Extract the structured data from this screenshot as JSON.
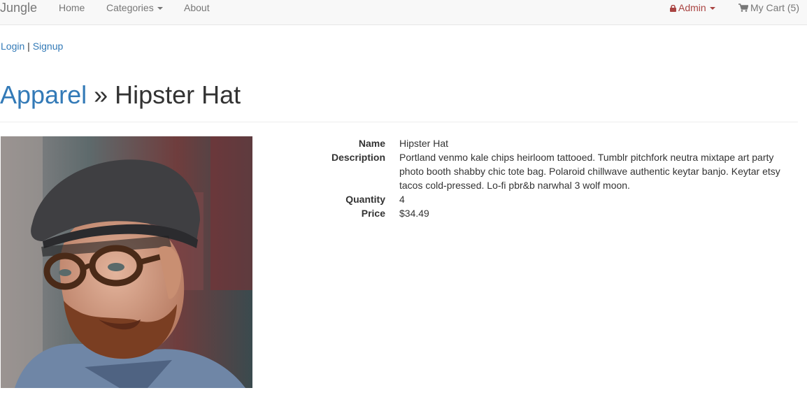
{
  "nav": {
    "brand": "Jungle",
    "home": "Home",
    "categories": "Categories",
    "about": "About",
    "admin": "Admin",
    "cart": "My Cart (5)"
  },
  "auth": {
    "login": "Login",
    "separator": " | ",
    "signup": "Signup"
  },
  "page": {
    "category": "Apparel",
    "separator": " » ",
    "product_name": "Hipster Hat"
  },
  "product": {
    "labels": {
      "name": "Name",
      "description": "Description",
      "quantity": "Quantity",
      "price": "Price"
    },
    "name": "Hipster Hat",
    "description": "Portland venmo kale chips heirloom tattooed. Tumblr pitchfork neutra mixtape art party photo booth shabby chic tote bag. Polaroid chillwave authentic keytar banjo. Keytar etsy tacos cold-pressed. Lo-fi pbr&b narwhal 3 wolf moon.",
    "quantity": "4",
    "price": "$34.49"
  },
  "colors": {
    "link": "#337ab7",
    "admin": "#a94442",
    "navbar_bg": "#f8f8f8",
    "nav_text": "#777777"
  },
  "icons": [
    "lock-icon",
    "cart-icon",
    "caret-down-icon"
  ]
}
